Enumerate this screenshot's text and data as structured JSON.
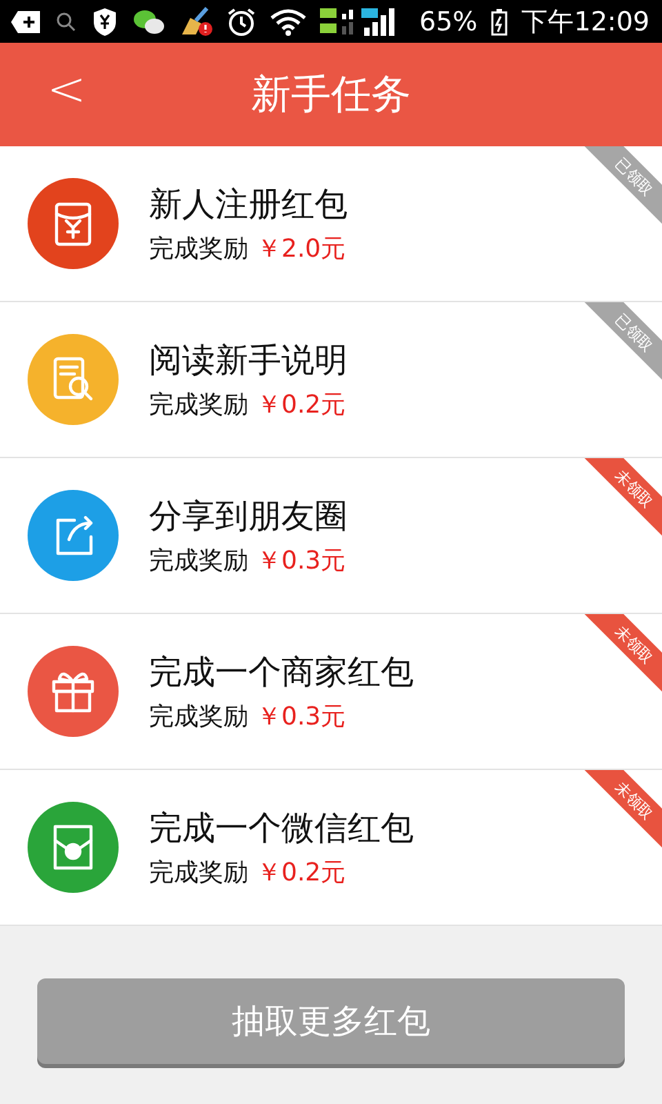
{
  "status_bar": {
    "battery": "65%",
    "time": "下午12:09"
  },
  "header": {
    "back": "<",
    "title": "新手任务"
  },
  "tasks": [
    {
      "kind": "envelope",
      "title": "新人注册红包",
      "reward_label": "完成奖励",
      "amount": "￥2.0元",
      "claimed": true,
      "badge": "已领取"
    },
    {
      "kind": "document",
      "title": "阅读新手说明",
      "reward_label": "完成奖励",
      "amount": "￥0.2元",
      "claimed": true,
      "badge": "已领取"
    },
    {
      "kind": "share",
      "title": "分享到朋友圈",
      "reward_label": "完成奖励",
      "amount": "￥0.3元",
      "claimed": false,
      "badge": "未领取"
    },
    {
      "kind": "gift",
      "title": "完成一个商家红包",
      "reward_label": "完成奖励",
      "amount": "￥0.3元",
      "claimed": false,
      "badge": "未领取"
    },
    {
      "kind": "wechat",
      "title": "完成一个微信红包",
      "reward_label": "完成奖励",
      "amount": "￥0.2元",
      "claimed": false,
      "badge": "未领取"
    }
  ],
  "button": "抽取更多红包"
}
